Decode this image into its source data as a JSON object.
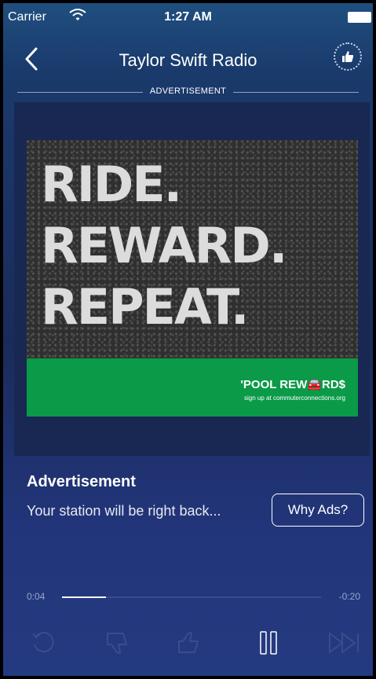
{
  "status_bar": {
    "carrier": "Carrier",
    "time": "1:27 AM"
  },
  "nav": {
    "title": "Taylor Swift Radio"
  },
  "ad_label": "ADVERTISEMENT",
  "ad_image": {
    "lines": [
      "RIDE.",
      "REWARD.",
      "REPEAT."
    ],
    "brand": "'POOL REW🚘RD$",
    "tagline": "sign up at commuterconnections.org"
  },
  "info": {
    "title": "Advertisement",
    "subtitle": "Your station will be right back...",
    "why_ads_label": "Why Ads?"
  },
  "playback": {
    "elapsed": "0:04",
    "remaining": "-0:20",
    "progress_fraction": 0.17
  },
  "icons": [
    "back-chevron-icon",
    "thumbs-up-icon",
    "replay-icon",
    "thumbs-down-icon",
    "pause-icon",
    "skip-icon",
    "wifi-icon",
    "battery-icon"
  ],
  "colors": {
    "accent": "#ffffff",
    "ad_green": "#0a9a48",
    "dim": "#3b4c8e"
  }
}
